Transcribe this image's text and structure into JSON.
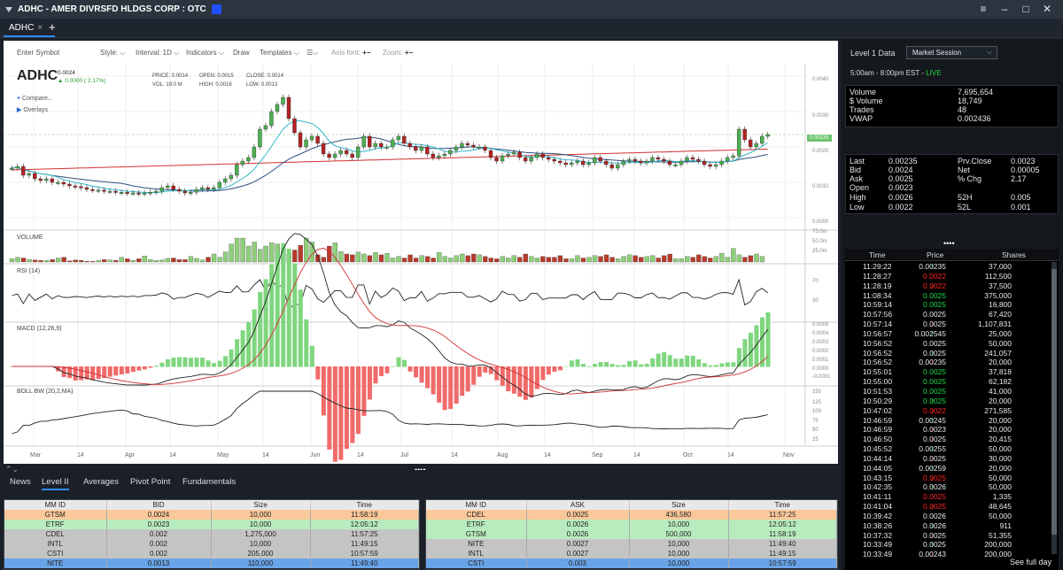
{
  "window": {
    "title": "ADHC - AMER DIVRSFD HLDGS CORP : OTC",
    "accent_color": "#1f4fff",
    "controls": [
      "menu-icon",
      "minimize-icon",
      "maximize-icon",
      "close-icon"
    ]
  },
  "tabs": [
    {
      "label": "ADHC",
      "close": "×"
    }
  ],
  "tab_add": "+",
  "toolbar": {
    "symbol_placeholder": "Enter Symbol",
    "style": "Style: ",
    "interval": "Interval: 1D",
    "indicators": "Indicators",
    "draw": "Draw",
    "templates": "Templates",
    "axis_font": "Axis font:",
    "zoom": "Zoom:"
  },
  "quote_header": {
    "symbol": "ADHC",
    "price": "0.0024",
    "change": "0.0000 ( 2.17%)",
    "price_lbl": "PRICE:",
    "price_val": "0.0014",
    "open_lbl": "OPEN:",
    "open_val": "0.0015",
    "close_lbl": "CLOSE:",
    "close_val": "0.0014",
    "vol_lbl": "VOL:",
    "vol_val": "19.0 M",
    "high_lbl": "HIGH:",
    "high_val": "0.0016",
    "low_lbl": "LOW:",
    "low_val": "0.0013",
    "compare": "Compare...",
    "overlays": "Overlays"
  },
  "price_axis": [
    "0.0040",
    "0.0030",
    "0.0020",
    "0.0010",
    "0.0000"
  ],
  "price_marker": "0.00235",
  "volume": {
    "label": "VOLUME",
    "axis": [
      "75.0m",
      "50.0m",
      "25.0m"
    ]
  },
  "rsi": {
    "label": "RSI (14)",
    "axis": [
      "70",
      "30"
    ]
  },
  "macd": {
    "label": "MACD (12,26,9)",
    "axis": [
      "0.0005",
      "0.0004",
      "0.0003",
      "0.0002",
      "0.0001",
      "0.0000",
      "-0.0001"
    ]
  },
  "bollbw": {
    "label": "BOLL BW (20,2,MA)",
    "axis": [
      "150",
      "125",
      "100",
      "75",
      "50",
      "25"
    ]
  },
  "x_axis": [
    "Mar",
    "14",
    "Apr",
    "14",
    "May",
    "14",
    "Jun",
    "14",
    "Jul",
    "14",
    "Aug",
    "14",
    "Sep",
    "14",
    "Oct",
    "14",
    "Nov"
  ],
  "chart_data": {
    "type": "candlestick",
    "series": [
      {
        "name": "Price",
        "close": [
          0.0014,
          0.00145,
          0.0012,
          0.00125,
          0.0011,
          0.00105,
          0.0011,
          0.001,
          0.001,
          0.00095,
          0.0009,
          0.00088,
          0.00085,
          0.0008,
          0.00078,
          0.00078,
          0.00075,
          0.00075,
          0.00072,
          0.00072,
          0.0007,
          0.0007,
          0.00068,
          0.0007,
          0.00072,
          0.00075,
          0.00085,
          0.0009,
          0.0008,
          0.00075,
          0.0007,
          0.00072,
          0.0008,
          0.00085,
          0.0008,
          0.00085,
          0.001,
          0.0011,
          0.0012,
          0.0015,
          0.0016,
          0.0017,
          0.002,
          0.0025,
          0.0026,
          0.003,
          0.0032,
          0.0034,
          0.0028,
          0.0024,
          0.002,
          0.0022,
          0.0023,
          0.0021,
          0.0018,
          0.0017,
          0.0018,
          0.0019,
          0.0018,
          0.0017,
          0.002,
          0.0023,
          0.002,
          0.0021,
          0.002,
          0.002,
          0.0022,
          0.0023,
          0.0021,
          0.002,
          0.0019,
          0.002,
          0.0018,
          0.0017,
          0.00175,
          0.0018,
          0.0019,
          0.002,
          0.0021,
          0.00205,
          0.002,
          0.002,
          0.0019,
          0.0017,
          0.0016,
          0.00175,
          0.0018,
          0.00185,
          0.0017,
          0.0016,
          0.0017,
          0.0018,
          0.0017,
          0.00165,
          0.0016,
          0.00155,
          0.0015,
          0.00155,
          0.0016,
          0.0015,
          0.00155,
          0.0017,
          0.0016,
          0.0015,
          0.0014,
          0.0015,
          0.0016,
          0.00165,
          0.0016,
          0.00155,
          0.0016,
          0.0017,
          0.00165,
          0.0016,
          0.0015,
          0.0015,
          0.0016,
          0.0017,
          0.00165,
          0.0016,
          0.0015,
          0.00145,
          0.0015,
          0.0016,
          0.0017,
          0.00175,
          0.0025,
          0.0022,
          0.002,
          0.0021,
          0.0023,
          0.00235
        ]
      },
      {
        "name": "Volume (m)",
        "values": [
          8,
          12,
          10,
          6,
          5,
          4,
          4,
          6,
          10,
          12,
          3,
          5,
          4,
          2,
          2,
          4,
          6,
          5,
          4,
          12,
          8,
          4,
          8,
          15,
          6,
          4,
          5,
          9,
          10,
          6,
          6,
          14,
          9,
          5,
          12,
          20,
          12,
          25,
          45,
          60,
          60,
          40,
          50,
          32,
          40,
          48,
          45,
          35,
          20,
          30,
          42,
          60,
          50,
          18,
          12,
          40,
          48,
          26,
          20,
          18,
          25,
          20,
          16,
          24,
          18,
          22,
          10,
          14,
          10,
          18,
          10,
          16,
          14,
          10,
          24,
          14,
          10,
          16,
          20,
          16,
          20,
          18,
          14,
          10,
          8,
          14,
          10,
          16,
          12,
          20,
          14,
          10,
          14,
          12,
          12,
          16,
          8,
          8,
          16,
          10,
          12,
          16,
          14,
          18,
          12,
          8,
          14,
          18,
          16,
          12,
          14,
          16,
          10,
          16,
          20,
          8,
          8,
          14,
          12,
          18,
          14,
          10,
          14,
          22,
          12,
          34,
          18,
          12,
          16,
          20,
          14
        ]
      }
    ]
  },
  "bottom_tabs": [
    "News",
    "Level II",
    "Averages",
    "Pivot Point",
    "Fundamentals"
  ],
  "bottom_active": "Level II",
  "level2": {
    "bid_headers": [
      "MM ID",
      "BID",
      "Size",
      "Time"
    ],
    "bid_rows": [
      {
        "mm": "GTSM",
        "price": "0.0024",
        "size": "10,000",
        "time": "11:58:19",
        "color": "orange"
      },
      {
        "mm": "ETRF",
        "price": "0.0023",
        "size": "10,000",
        "time": "12:05:12",
        "color": "green"
      },
      {
        "mm": "CDEL",
        "price": "0.002",
        "size": "1,275,000",
        "time": "11:57:25",
        "color": "gray"
      },
      {
        "mm": "INTL",
        "price": "0.002",
        "size": "10,000",
        "time": "11:49:15",
        "color": "gray"
      },
      {
        "mm": "CSTI",
        "price": "0.002",
        "size": "205,000",
        "time": "10:57:59",
        "color": "gray"
      },
      {
        "mm": "NITE",
        "price": "0.0013",
        "size": "110,000",
        "time": "11:49:40",
        "color": "blue"
      }
    ],
    "ask_headers": [
      "MM ID",
      "ASK",
      "Size",
      "Time"
    ],
    "ask_rows": [
      {
        "mm": "CDEL",
        "price": "0.0025",
        "size": "436,580",
        "time": "11:57:25",
        "color": "orange"
      },
      {
        "mm": "ETRF",
        "price": "0.0026",
        "size": "10,000",
        "time": "12:05:12",
        "color": "green"
      },
      {
        "mm": "GTSM",
        "price": "0.0026",
        "size": "500,000",
        "time": "11:58:19",
        "color": "green"
      },
      {
        "mm": "NITE",
        "price": "0.0027",
        "size": "10,000",
        "time": "11:49:40",
        "color": "gray"
      },
      {
        "mm": "INTL",
        "price": "0.0027",
        "size": "10,000",
        "time": "11:49:15",
        "color": "gray"
      },
      {
        "mm": "CSTI",
        "price": "0.003",
        "size": "10,000",
        "time": "10:57:59",
        "color": "blue"
      }
    ]
  },
  "level1": {
    "label": "Level 1 Data",
    "session_select": "Market Session",
    "hours": "5:00am - 8:00pm EST - ",
    "live": "LIVE",
    "stats": [
      {
        "k": "Volume",
        "v": "7,695,654"
      },
      {
        "k": "$ Volume",
        "v": "18,749"
      },
      {
        "k": " Trades",
        "v": "48"
      },
      {
        "k": " VWAP",
        "v": "0.002436"
      }
    ],
    "quote": {
      "last_k": "Last",
      "last_v": "0.00235",
      "prv_k": "Prv.Close",
      "prv_v": "0.0023",
      "bid_k": "Bid",
      "bid_v": "0.0024",
      "net_k": "Net",
      "net_v": "0.00005",
      "ask_k": "Ask",
      "ask_v": "0.0025",
      "pct_k": "% Chg",
      "pct_v": "2.17",
      "open_k": "Open",
      "open_v": "0.0023",
      "high_k": "High",
      "high_v": "0.0026",
      "h52_k": "52H",
      "h52_v": "0.005",
      "low_k": "Low",
      "low_v": "0.0022",
      "l52_k": "52L",
      "l52_v": "0.001"
    }
  },
  "time_sales": {
    "headers": [
      "Time",
      "Price",
      "Shares"
    ],
    "rows": [
      {
        "t": "11:29:22",
        "p": "0.00235",
        "s": "37,000",
        "d": "up",
        "c": "white"
      },
      {
        "t": "11:28:27",
        "p": "0.0022",
        "s": "112,500",
        "d": "",
        "c": "red"
      },
      {
        "t": "11:28:19",
        "p": "0.0022",
        "s": "37,500",
        "d": "dn",
        "c": "red"
      },
      {
        "t": "11:08:34",
        "p": "0.0025",
        "s": "375,000",
        "d": "",
        "c": "green"
      },
      {
        "t": "10:59:14",
        "p": "0.0025",
        "s": "16,800",
        "d": "",
        "c": "green"
      },
      {
        "t": "10:57:56",
        "p": "0.0025",
        "s": "67,420",
        "d": "",
        "c": "white"
      },
      {
        "t": "10:57:14",
        "p": "0.0025",
        "s": "1,107,831",
        "d": "dn",
        "c": "white"
      },
      {
        "t": "10:56:57",
        "p": "0.002545",
        "s": "25,000",
        "d": "up",
        "c": "white"
      },
      {
        "t": "10:56:52",
        "p": "0.0025",
        "s": "50,000",
        "d": "",
        "c": "white"
      },
      {
        "t": "10:56:52",
        "p": "0.0025",
        "s": "241,057",
        "d": "up",
        "c": "white"
      },
      {
        "t": "10:56:52",
        "p": "0.00235",
        "s": "20,000",
        "d": "dn",
        "c": "white"
      },
      {
        "t": "10:55:01",
        "p": "0.0025",
        "s": "37,818",
        "d": "",
        "c": "green"
      },
      {
        "t": "10:55:00",
        "p": "0.0025",
        "s": "62,182",
        "d": "",
        "c": "green"
      },
      {
        "t": "10:51:53",
        "p": "0.0025",
        "s": "41,000",
        "d": "",
        "c": "green"
      },
      {
        "t": "10:50:29",
        "p": "0.0025",
        "s": "20,000",
        "d": "up",
        "c": "green"
      },
      {
        "t": "10:47:02",
        "p": "0.0022",
        "s": "271,585",
        "d": "dn",
        "c": "red"
      },
      {
        "t": "10:46:59",
        "p": "0.00245",
        "s": "20,000",
        "d": "up",
        "c": "white"
      },
      {
        "t": "10:46:59",
        "p": "0.0023",
        "s": "20,000",
        "d": "dn",
        "c": "white"
      },
      {
        "t": "10:46:50",
        "p": "0.0025",
        "s": "20,415",
        "d": "dn",
        "c": "white"
      },
      {
        "t": "10:45:52",
        "p": "0.00255",
        "s": "50,000",
        "d": "up",
        "c": "white"
      },
      {
        "t": "10:44:14",
        "p": "0.0025",
        "s": "30,000",
        "d": "dn",
        "c": "white"
      },
      {
        "t": "10:44:05",
        "p": "0.00259",
        "s": "20,000",
        "d": "up",
        "c": "white"
      },
      {
        "t": "10:43:15",
        "p": "0.0025",
        "s": "50,000",
        "d": "dn",
        "c": "red"
      },
      {
        "t": "10:42:35",
        "p": "0.0026",
        "s": "50,000",
        "d": "up",
        "c": "white"
      },
      {
        "t": "10:41:11",
        "p": "0.0025",
        "s": "1,335",
        "d": "",
        "c": "red"
      },
      {
        "t": "10:41:04",
        "p": "0.0025",
        "s": "48,645",
        "d": "dn",
        "c": "red"
      },
      {
        "t": "10:39:42",
        "p": "0.0026",
        "s": "50,000",
        "d": "",
        "c": "white"
      },
      {
        "t": "10:38:26",
        "p": "0.0026",
        "s": "911",
        "d": "up",
        "c": "white"
      },
      {
        "t": "10:37:32",
        "p": "0.0025",
        "s": "51,355",
        "d": "dn",
        "c": "white"
      },
      {
        "t": "10:33:49",
        "p": "0.0025",
        "s": "200,000",
        "d": "up",
        "c": "white"
      },
      {
        "t": "10:33:49",
        "p": "0.00243",
        "s": "200,000",
        "d": "dn",
        "c": "white"
      }
    ],
    "see_full": "See full day"
  },
  "colors": {
    "up_candle": "#4caf50",
    "down_candle": "#b22222",
    "vol_up": "#8fcf7a",
    "vol_down": "#b83a2a",
    "ma_red": "#d23030",
    "ma_blue": "#2f4f7f",
    "ma_cyan": "#30b8c8",
    "live_green": "#1ede3a"
  }
}
